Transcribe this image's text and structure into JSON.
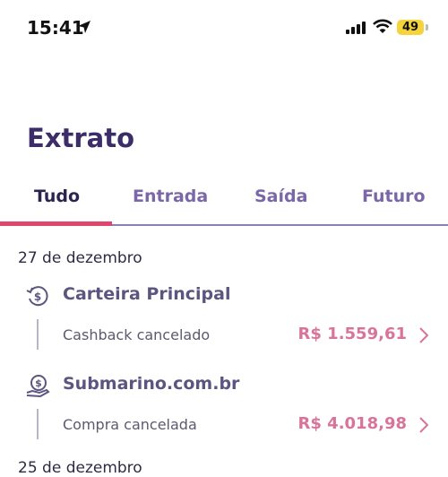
{
  "status": {
    "time": "15:41",
    "battery": "49"
  },
  "page": {
    "title": "Extrato"
  },
  "tabs": [
    {
      "label": "Tudo",
      "active": true
    },
    {
      "label": "Entrada",
      "active": false
    },
    {
      "label": "Saída",
      "active": false
    },
    {
      "label": "Futuro",
      "active": false
    }
  ],
  "groups": [
    {
      "date": "27 de dezembro",
      "transactions": [
        {
          "title": "Carteira Principal",
          "description": "Cashback cancelado",
          "amount": "R$ 1.559,61",
          "icon": "cashback-refresh-icon"
        },
        {
          "title": "Submarino.com.br",
          "description": "Compra cancelada",
          "amount": "R$ 4.018,98",
          "icon": "money-hand-icon"
        }
      ]
    },
    {
      "date": "25 de dezembro",
      "transactions": []
    }
  ],
  "colors": {
    "accent": "#e0456d",
    "title": "#3c2d68",
    "amount": "#d8749a",
    "tab_inactive": "#7b67a7"
  }
}
